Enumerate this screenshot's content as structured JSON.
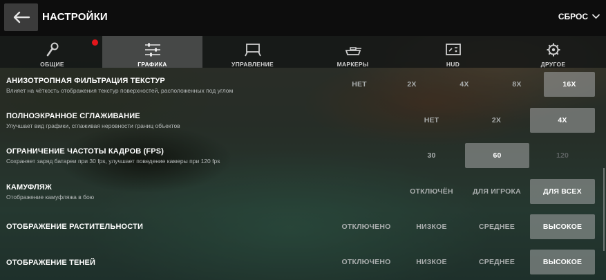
{
  "header": {
    "title": "НАСТРОЙКИ",
    "reset_label": "СБРОС"
  },
  "tabs": [
    {
      "label": "ОБЩИЕ",
      "icon": "wrench-icon",
      "active": false,
      "notification": true
    },
    {
      "label": "ГРАФИКА",
      "icon": "sliders-icon",
      "active": true,
      "notification": false
    },
    {
      "label": "УПРАВЛЕНИЕ",
      "icon": "controls-icon",
      "active": false,
      "notification": false
    },
    {
      "label": "МАРКЕРЫ",
      "icon": "tank-icon",
      "active": false,
      "notification": false
    },
    {
      "label": "HUD",
      "icon": "hud-icon",
      "active": false,
      "notification": false
    },
    {
      "label": "ДРУГОЕ",
      "icon": "gear-icon",
      "active": false,
      "notification": false
    }
  ],
  "settings": [
    {
      "title": "АНИЗОТРОПНАЯ ФИЛЬТРАЦИЯ ТЕКСТУР",
      "desc": "Влияет на чёткость отображения текстур поверхностей, расположенных под углом",
      "options": [
        "НЕТ",
        "2X",
        "4X",
        "8X",
        "16X"
      ],
      "selected": 4
    },
    {
      "title": "ПОЛНОЭКРАННОЕ СГЛАЖИВАНИЕ",
      "desc": "Улучшает вид графики, сглаживая неровности границ объектов",
      "options": [
        "НЕТ",
        "2X",
        "4X"
      ],
      "selected": 2
    },
    {
      "title": "ОГРАНИЧЕНИЕ ЧАСТОТЫ КАДРОВ (FPS)",
      "desc": "Сохраняет заряд батареи при 30 fps, улучшает поведение камеры при 120 fps",
      "options": [
        "30",
        "60",
        "120"
      ],
      "selected": 1,
      "disabled": [
        2
      ]
    },
    {
      "title": "КАМУФЛЯЖ",
      "desc": "Отображение камуфляжа в бою",
      "options": [
        "ОТКЛЮЧЁН",
        "ДЛЯ ИГРОКА",
        "ДЛЯ ВСЕХ"
      ],
      "selected": 2
    },
    {
      "title": "ОТОБРАЖЕНИЕ РАСТИТЕЛЬНОСТИ",
      "desc": "",
      "options": [
        "ОТКЛЮЧЕНО",
        "НИЗКОЕ",
        "СРЕДНЕЕ",
        "ВЫСОКОЕ"
      ],
      "selected": 3
    },
    {
      "title": "ОТОБРАЖЕНИЕ ТЕНЕЙ",
      "desc": "",
      "options": [
        "ОТКЛЮЧЕНО",
        "НИЗКОЕ",
        "СРЕДНЕЕ",
        "ВЫСОКОЕ"
      ],
      "selected": 3
    }
  ],
  "colors": {
    "header_bg": "#0d0d0d",
    "selected_bg": "#8a8d8d",
    "notification": "#e3161b"
  }
}
